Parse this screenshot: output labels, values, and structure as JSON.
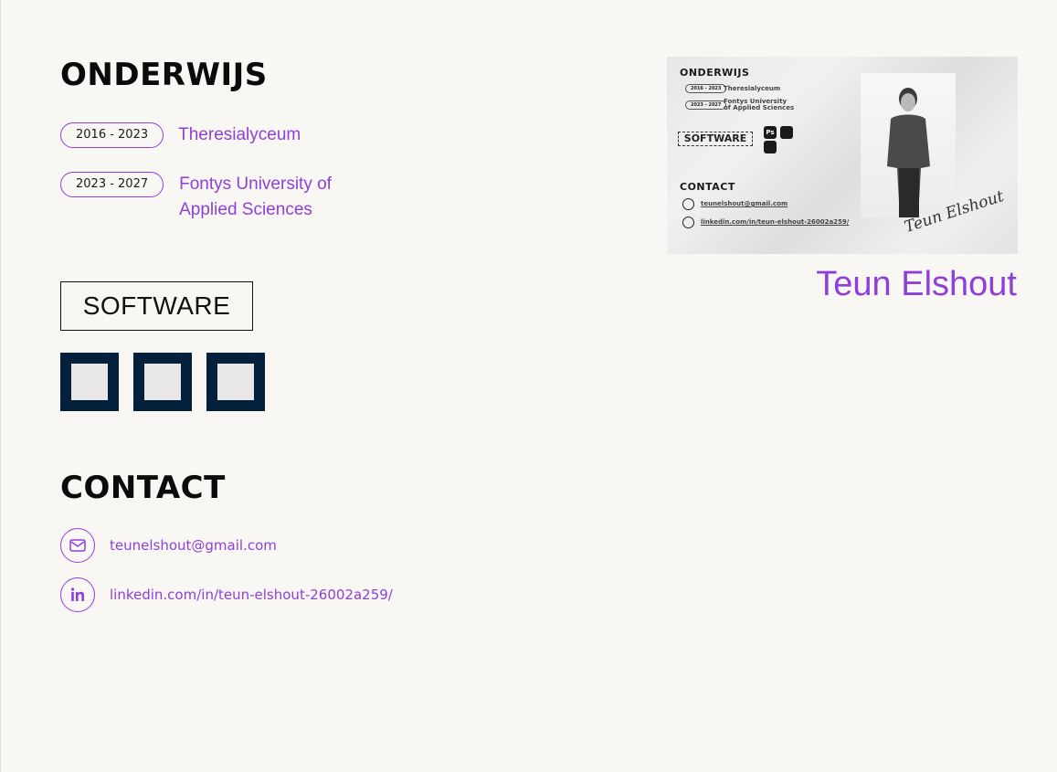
{
  "education": {
    "title": "ONDERWIJS",
    "items": [
      {
        "years": "2016 - 2023",
        "school": "Theresialyceum"
      },
      {
        "years": "2023 - 2027",
        "school": "Fontys University of Applied Sciences"
      }
    ]
  },
  "software": {
    "title": "SOFTWARE",
    "tiles": [
      "software-tile-1",
      "software-tile-2",
      "software-tile-3"
    ]
  },
  "contact": {
    "title": "CONTACT",
    "email": "teunelshout@gmail.com",
    "linkedin": "linkedin.com/in/teun-elshout-26002a259/",
    "icons": [
      "mail-icon",
      "linkedin-icon"
    ]
  },
  "preview": {
    "title": "ONDERWIJS",
    "edu1_years": "2016 - 2023",
    "edu1_school": "Theresialyceum",
    "edu2_years": "2023 - 2027",
    "edu2_school_line1": "Fontys University",
    "edu2_school_line2": "of Applied Sciences",
    "software_title": "SOFTWARE",
    "icon_ps": "Ps",
    "contact_title": "CONTACT",
    "email": "teunelshout@gmail.com",
    "linkedin": "linkedin.com/in/teun-elshout-26002a259/",
    "signature": "Teun Elshout"
  },
  "profile": {
    "name": "Teun Elshout"
  },
  "colors": {
    "accent": "#8f3fd9",
    "background": "#f9f7f4",
    "tile": "#03213b"
  }
}
